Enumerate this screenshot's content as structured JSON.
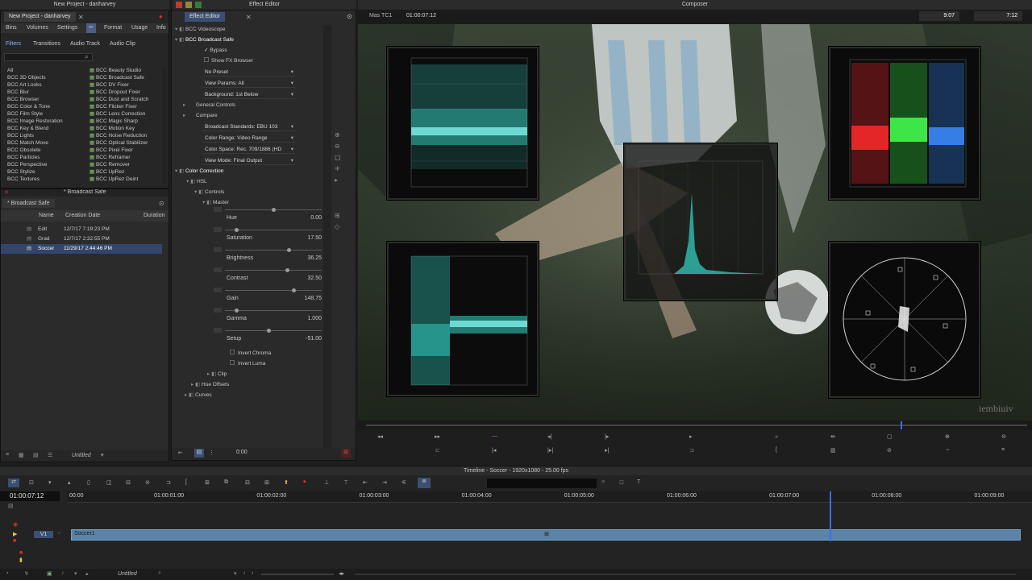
{
  "bin_window": {
    "title": "New Project - danharvey",
    "active_tab": "New Project - danharvey",
    "tabs": [
      "Bins",
      "Volumes",
      "Settings",
      "Format",
      "Usage",
      "Info"
    ],
    "subtabs": [
      "Filters",
      "Transitions",
      "Audio Track",
      "Audio Clip"
    ],
    "categories": [
      "All",
      "BCC 3D Objects",
      "BCC Art Looks",
      "BCC Blur",
      "BCC Browser",
      "BCC Color & Tone",
      "BCC Film Style",
      "BCC Image Restoration",
      "BCC Key & Blend",
      "BCC Lights",
      "BCC Match Move",
      "BCC Obsolete",
      "BCC Particles",
      "BCC Perspective",
      "BCC Stylize",
      "BCC Textures"
    ],
    "effects": [
      "BCC Beauty Studio",
      "BCC Broadcast Safe",
      "BCC DV Fixer",
      "BCC Dropout Fixer",
      "BCC Dust and Scratch",
      "BCC Flicker Fixer",
      "BCC Lens Correction",
      "BCC Magic Sharp",
      "BCC Motion Key",
      "BCC Noise Reduction",
      "BCC Optical Stabilizer",
      "BCC Pixel Fixer",
      "BCC Reframer",
      "BCC Remover",
      "BCC UpRez",
      "BCC UpRez Deint"
    ],
    "bin_title": "* Broadcast Safe",
    "bin_tab": "* Broadcast Safe",
    "columns": [
      "Name",
      "Creation Date",
      "Duration"
    ],
    "rows": [
      {
        "name": "Edit",
        "date": "12/7/17 7:19:23 PM"
      },
      {
        "name": "Grad",
        "date": "12/7/17 2:32:55 PM"
      },
      {
        "name": "Soccer",
        "date": "11/29/17 2:44:46 PM"
      }
    ],
    "footer_label": "Untitled"
  },
  "effect_editor": {
    "title": "Effect Editor",
    "tab": "Effect Editor",
    "items": {
      "videoscope": "BCC Videoscope",
      "broadcast_safe": "BCC Broadcast Safe",
      "bypass": "Bypass",
      "show_fx_browser": "Show FX Browser",
      "preset": "No Preset",
      "view_params": "View Params: All",
      "background": "Background: 1st Below",
      "general_controls": "General Controls",
      "compare": "Compare",
      "broadcast_standards": "Broadcast Standards: EBU 103",
      "color_range": "Color Range: Video Range",
      "color_space": "Color Space: Rec. 709/1886 (HD",
      "view_mode": "View Mode: Final Output",
      "color_correction": "Color Correction",
      "hsl": "HSL",
      "controls": "Controls",
      "master": "Master",
      "invert_chroma": "Invert Chroma",
      "invert_luma": "Invert Luma",
      "clip": "Clip",
      "hue_offsets": "Hue Offsets",
      "curves": "Curves"
    },
    "params": [
      {
        "label": "Hue",
        "value": "0.00",
        "pos": 0.5
      },
      {
        "label": "Saturation",
        "value": "17.50",
        "pos": 0.1
      },
      {
        "label": "Brightness",
        "value": "36.25",
        "pos": 0.67
      },
      {
        "label": "Contrast",
        "value": "32.50",
        "pos": 0.65
      },
      {
        "label": "Gain",
        "value": "148.75",
        "pos": 0.72
      },
      {
        "label": "Gamma",
        "value": "1.000",
        "pos": 0.1
      },
      {
        "label": "Setup",
        "value": "-51.00",
        "pos": 0.45
      }
    ],
    "footer_time": "0:00"
  },
  "composer": {
    "title": "Composer",
    "tc_label": "Mas TC1",
    "timecode": "01:00:07:12",
    "readout_1": "9:07",
    "readout_2": "7:12",
    "watermark": "iembiuiv"
  },
  "timeline": {
    "title": "Timeline - Soccer - 1920x1080 - 25.00 fps",
    "timecode": "01:00:07:12",
    "ruler": [
      "00:00",
      "01:00:01:00",
      "01:00:02:00",
      "01:00:03:00",
      "01:00:04:00",
      "01:00:05:00",
      "01:00:06:00",
      "01:00:07:00",
      "01:00:08:00",
      "01:00:09:00"
    ],
    "track": "V1",
    "clip_name": "Soccer1",
    "footer_label": "Untitled",
    "playhead_fraction": 0.79
  },
  "colors": {
    "accent": "#3b6ea8",
    "clip": "#5b83a8",
    "selected_row": "#34456a",
    "playhead": "#3a6df0",
    "scope_cyan": "#34d6c8"
  }
}
